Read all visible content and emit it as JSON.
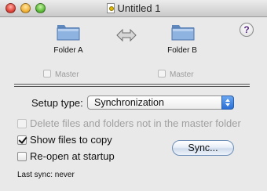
{
  "window": {
    "title": "Untitled 1"
  },
  "folders": {
    "a": {
      "label": "Folder A",
      "master_label": "Master"
    },
    "b": {
      "label": "Folder B",
      "master_label": "Master"
    }
  },
  "help_label": "?",
  "setup": {
    "label": "Setup type:",
    "selected": "Synchronization"
  },
  "options": {
    "delete_label": "Delete files and folders not in the master folder",
    "show_label": "Show files to copy",
    "reopen_label": "Re-open at startup",
    "show_checked": true
  },
  "sync_button": "Sync...",
  "status": {
    "last_sync": "Last sync: never"
  },
  "colors": {
    "folder_blue": "#7fa6d6",
    "accent": "#2a6fd6"
  }
}
